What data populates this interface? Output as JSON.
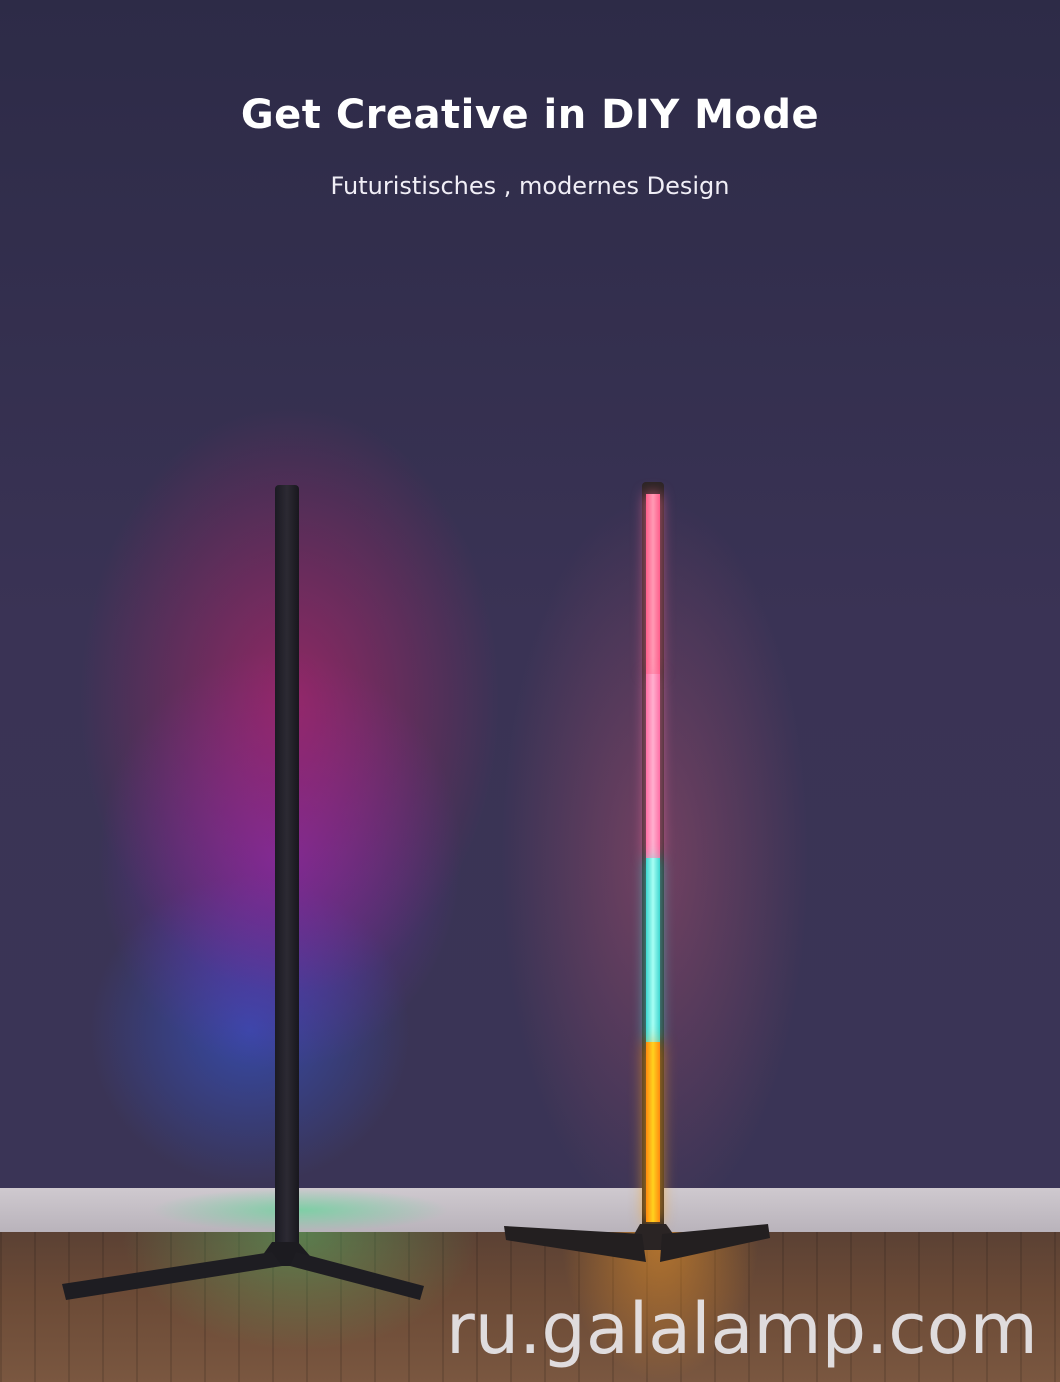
{
  "header": {
    "title": "Get Creative in DIY Mode",
    "subtitle": "Futuristisches , modernes Design"
  },
  "watermark": {
    "text": "ru.galalamp.com"
  },
  "colors": {
    "background": "#2f2d4a",
    "glow_magenta": "#d61e6e",
    "glow_violet": "#8c28dc",
    "glow_blue": "#325ae6",
    "segment_pink": "#ff7fa0",
    "segment_cyan": "#6ee8e0",
    "segment_yellow": "#ffc418"
  }
}
